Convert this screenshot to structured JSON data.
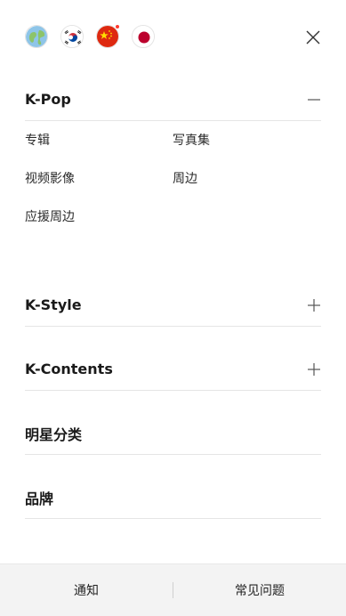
{
  "languages": [
    {
      "name": "globe-icon"
    },
    {
      "name": "korea-flag-icon"
    },
    {
      "name": "china-flag-icon",
      "notification": true
    },
    {
      "name": "japan-flag-icon"
    }
  ],
  "menu": {
    "kpop": {
      "title": "K-Pop",
      "expanded": true,
      "items": [
        "专辑",
        "写真集",
        "视频影像",
        "周边",
        "应援周边"
      ]
    },
    "kstyle": {
      "title": "K-Style",
      "expanded": false
    },
    "kcontents": {
      "title": "K-Contents",
      "expanded": false
    },
    "stars": {
      "title": "明星分类"
    },
    "brands": {
      "title": "品牌"
    }
  },
  "bottom": {
    "notice": "通知",
    "faq": "常见问题"
  },
  "colors": {
    "notification_dot": "#ff3b30",
    "bottom_bg": "#f3f3f3"
  }
}
